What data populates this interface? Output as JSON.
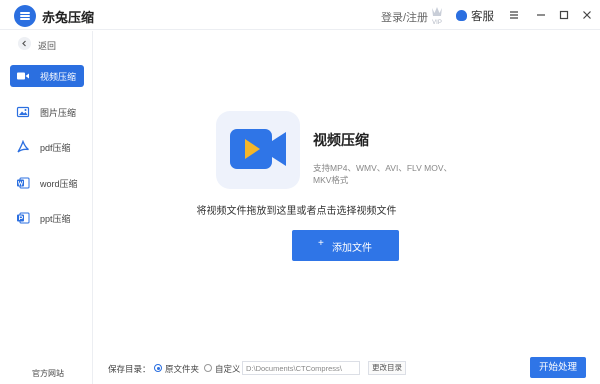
{
  "app": {
    "title": "赤兔压缩"
  },
  "header": {
    "login_label": "登录/注册",
    "vip_label": "VIP",
    "support_label": "客服"
  },
  "sidebar": {
    "back_label": "返回",
    "items": [
      {
        "label": "视频压缩",
        "icon": "video-camera-icon",
        "active": true
      },
      {
        "label": "图片压缩",
        "icon": "image-icon",
        "active": false
      },
      {
        "label": "pdf压缩",
        "icon": "pdf-icon",
        "active": false
      },
      {
        "label": "word压缩",
        "icon": "word-icon",
        "active": false
      },
      {
        "label": "ppt压缩",
        "icon": "ppt-icon",
        "active": false
      }
    ],
    "site_link": "官方网站"
  },
  "main": {
    "title": "视频压缩",
    "formats": "支持MP4、WMV、AVI、FLV MOV、MKV格式",
    "drop_hint": "将视频文件拖放到这里或者点击选择视频文件",
    "add_button_label": "添加文件",
    "add_button_icon": "+"
  },
  "bottom": {
    "save_dir_label": "保存目录：",
    "option_source": "原文件夹",
    "option_custom": "自定义",
    "selected_option": "原文件夹",
    "path_value": "D:\\Documents\\CTCompress\\",
    "change_dir_label": "更改目录",
    "start_label": "开始处理"
  },
  "colors": {
    "accent": "#2f75e7",
    "icon_bg": "#eef2fb",
    "play": "#f5b62a"
  }
}
